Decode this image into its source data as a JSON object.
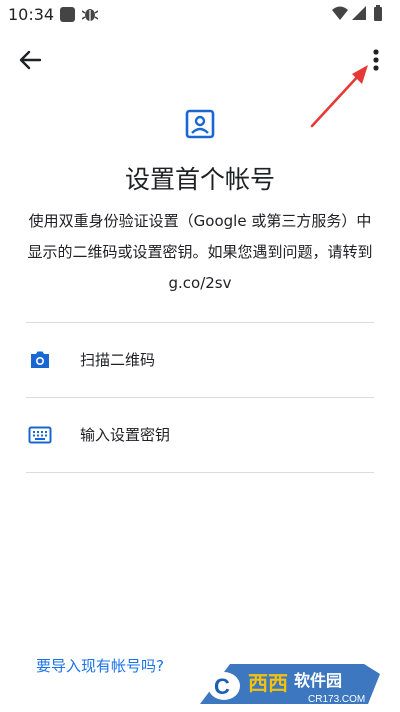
{
  "status_bar": {
    "time": "10:34",
    "icons": [
      "app-square-icon",
      "bug-icon",
      "wifi-icon",
      "signal-icon",
      "battery-icon"
    ]
  },
  "toolbar": {
    "back_icon": "arrow-back-icon",
    "more_icon": "more-vert-icon"
  },
  "header": {
    "icon": "account-box-icon",
    "title": "设置首个帐号",
    "description": "使用双重身份验证设置（Google 或第三方服务）中显示的二维码或设置密钥。如果您遇到问题，请转到 g.co/2sv"
  },
  "options": [
    {
      "icon": "camera-icon",
      "label": "扫描二维码"
    },
    {
      "icon": "keyboard-icon",
      "label": "输入设置密钥"
    }
  ],
  "footer": {
    "import_link": "要导入现有帐号吗?"
  },
  "watermark": {
    "brand": "西西软件园",
    "url": "CR173.COM"
  },
  "colors": {
    "accent": "#1a73e8",
    "icon_blue": "#1967d2",
    "annotation_red": "#e53935",
    "divider": "#dadce0"
  }
}
